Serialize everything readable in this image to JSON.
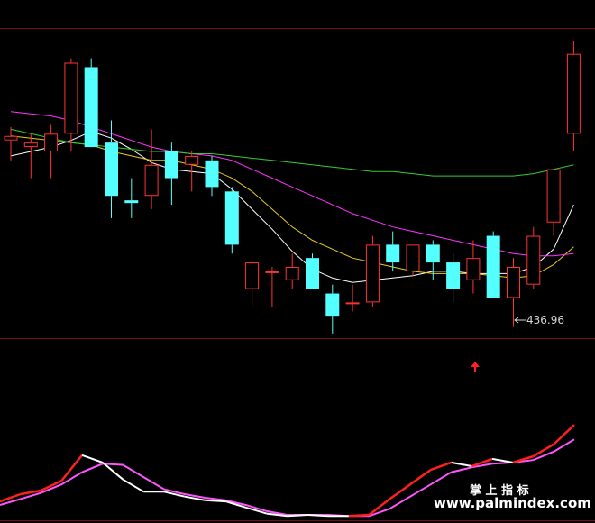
{
  "chart_data": {
    "type": "candlestick",
    "price_range": [
      420,
      485
    ],
    "candles": [
      {
        "o": 461.5,
        "h": 464.5,
        "l": 457,
        "c": 462.5
      },
      {
        "o": 460,
        "h": 463,
        "l": 453,
        "c": 461
      },
      {
        "o": 459,
        "h": 465,
        "l": 453,
        "c": 463
      },
      {
        "o": 463,
        "h": 480,
        "l": 459,
        "c": 479
      },
      {
        "o": 478,
        "h": 480,
        "l": 460,
        "c": 460
      },
      {
        "o": 461,
        "h": 466,
        "l": 444,
        "c": 449
      },
      {
        "o": 448,
        "h": 453,
        "l": 444,
        "c": 447.5
      },
      {
        "o": 449,
        "h": 464,
        "l": 446,
        "c": 456
      },
      {
        "o": 459,
        "h": 461,
        "l": 447,
        "c": 453
      },
      {
        "o": 456,
        "h": 459,
        "l": 450,
        "c": 458
      },
      {
        "o": 457,
        "h": 458,
        "l": 449,
        "c": 451
      },
      {
        "o": 450,
        "h": 451,
        "l": 436,
        "c": 438
      },
      {
        "o": 428,
        "h": 434,
        "l": 424,
        "c": 434
      },
      {
        "o": 432,
        "h": 433,
        "l": 424,
        "c": 432
      },
      {
        "o": 430,
        "h": 436,
        "l": 428,
        "c": 433
      },
      {
        "o": 435,
        "h": 436,
        "l": 428,
        "c": 428
      },
      {
        "o": 427,
        "h": 429,
        "l": 418,
        "c": 422
      },
      {
        "o": 425,
        "h": 429,
        "l": 423,
        "c": 425
      },
      {
        "o": 425,
        "h": 440,
        "l": 424,
        "c": 438
      },
      {
        "o": 438,
        "h": 441,
        "l": 432,
        "c": 434
      },
      {
        "o": 432,
        "h": 438,
        "l": 431,
        "c": 438
      },
      {
        "o": 438,
        "h": 439,
        "l": 430,
        "c": 434
      },
      {
        "o": 434,
        "h": 436,
        "l": 425,
        "c": 428
      },
      {
        "o": 430,
        "h": 439,
        "l": 427,
        "c": 435
      },
      {
        "o": 440,
        "h": 441,
        "l": 426,
        "c": 426
      },
      {
        "o": 426,
        "h": 435,
        "l": 419.5,
        "c": 433
      },
      {
        "o": 429,
        "h": 442,
        "l": 428,
        "c": 440
      },
      {
        "o": 443,
        "h": 455,
        "l": 440,
        "c": 455
      },
      {
        "o": 463,
        "h": 484,
        "l": 459,
        "c": 481
      }
    ],
    "ma_lines": [
      {
        "color": "#ffffff",
        "values": [
          458,
          459,
          460,
          461.5,
          463.5,
          462,
          459.5,
          456.5,
          455,
          454.5,
          454,
          450.5,
          446,
          441.5,
          436.5,
          432.5,
          430.5,
          429.5,
          430,
          430.5,
          431,
          432,
          432,
          431.5,
          431.5,
          431.5,
          433,
          437,
          447
        ]
      },
      {
        "color": "#e6cc20",
        "values": [
          462.5,
          462,
          461.5,
          461,
          460.5,
          459,
          458,
          457,
          457,
          456,
          455,
          453,
          450,
          446,
          442,
          439,
          437,
          435,
          434,
          433,
          432,
          431.5,
          431.5,
          431.5,
          431,
          430.5,
          431,
          433.5,
          437.5
        ]
      },
      {
        "color": "#ff33ff",
        "values": [
          468,
          467.5,
          467,
          466,
          464.5,
          463,
          461.5,
          460,
          459,
          458.5,
          458,
          457,
          455,
          453,
          451,
          449,
          447,
          445,
          443.5,
          442,
          441,
          440,
          439,
          438,
          437,
          436,
          435.5,
          435.5,
          436
        ]
      },
      {
        "color": "#33cc33",
        "values": [
          464,
          463,
          462,
          461,
          460.5,
          460,
          459.5,
          459,
          459,
          458.5,
          458.5,
          458,
          457.5,
          457,
          456.5,
          456,
          455.5,
          455,
          454.5,
          454.5,
          454,
          453.5,
          453.5,
          453.5,
          453.5,
          453.5,
          454,
          455,
          456
        ]
      }
    ],
    "low_label": "436.96",
    "indicator": {
      "range": [
        0,
        100
      ],
      "k": [
        14,
        20,
        23,
        31,
        52,
        46,
        32,
        22,
        22,
        18,
        15,
        14,
        9,
        4,
        2,
        3,
        2,
        2,
        3,
        16,
        28,
        40,
        46,
        43,
        49,
        46,
        51,
        61,
        77
      ],
      "d": [
        11,
        16,
        21,
        28,
        38,
        45,
        44,
        34,
        24,
        20,
        17,
        15,
        11,
        6,
        3,
        3,
        3,
        2,
        2,
        8,
        18,
        28,
        38,
        42,
        45,
        46,
        48,
        55,
        65
      ],
      "k_color": "#ffffff",
      "d_color": "#ff55ff",
      "highlight_color": "#ff2020"
    }
  },
  "watermark": {
    "cn": "掌 上 指 标",
    "url": "www.palmindex.com"
  }
}
